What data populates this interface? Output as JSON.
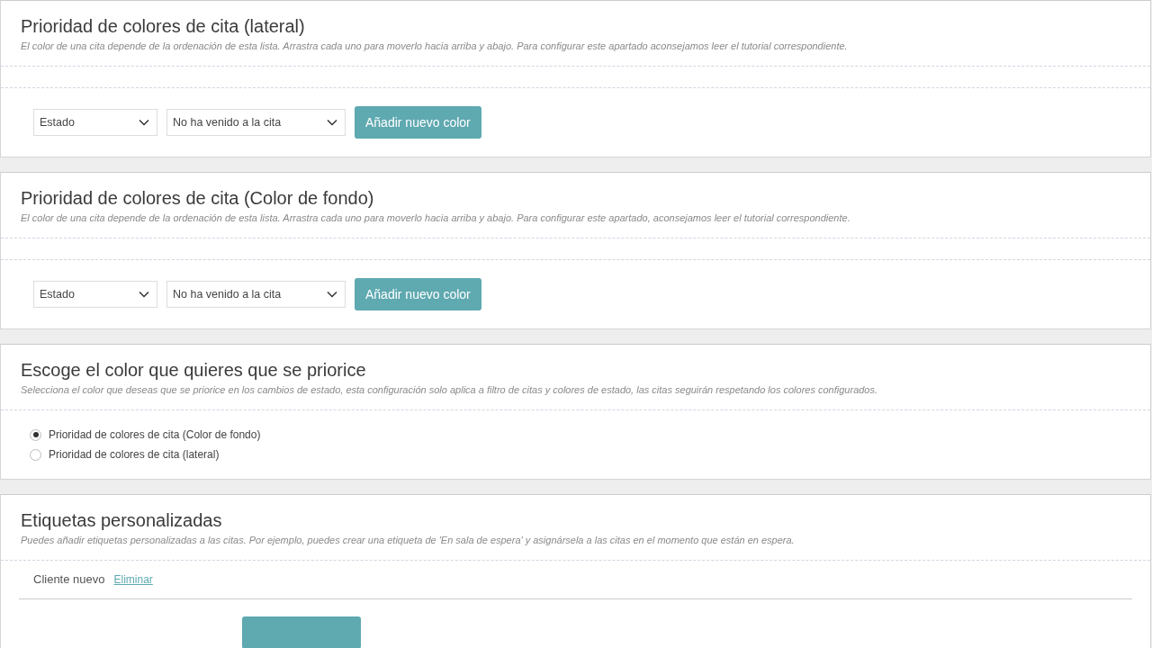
{
  "sections": [
    {
      "kind": "color_priority",
      "title": "Prioridad de colores de cita (lateral)",
      "description": "El color de una cita depende de la ordenación de esta lista. Arrastra cada uno para moverlo hacia arriba y abajo. Para configurar este apartado aconsejamos leer el tutorial correspondiente.",
      "selects": [
        "Estado",
        "No ha venido a la cita"
      ],
      "button": "Añadir nuevo color"
    },
    {
      "kind": "color_priority",
      "title": "Prioridad de colores de cita (Color de fondo)",
      "description": "El color de una cita depende de la ordenación de esta lista. Arrastra cada uno para moverlo hacia arriba y abajo. Para configurar este apartado, aconsejamos leer el tutorial correspondiente.",
      "selects": [
        "Estado",
        "No ha venido a la cita"
      ],
      "button": "Añadir nuevo color"
    },
    {
      "kind": "radio",
      "title": "Escoge el color que quieres que se priorice",
      "description": "Selecciona el color que deseas que se priorice en los cambios de estado, esta configuración solo aplica a filtro de citas y colores de estado, las citas seguirán respetando los colores configurados.",
      "options": [
        {
          "label": "Prioridad de colores de cita (Color de fondo)",
          "selected": true
        },
        {
          "label": "Prioridad de colores de cita (lateral)",
          "selected": false
        }
      ]
    },
    {
      "kind": "tags",
      "title": "Etiquetas personalizadas",
      "description": "Puedes añadir etiquetas personalizadas a las citas. Por ejemplo, puedes crear una etiqueta de 'En sala de espera' y asignársela a las citas en el momento que están en espera.",
      "tags": [
        {
          "label": "Cliente nuevo",
          "action": "Eliminar"
        }
      ]
    }
  ]
}
